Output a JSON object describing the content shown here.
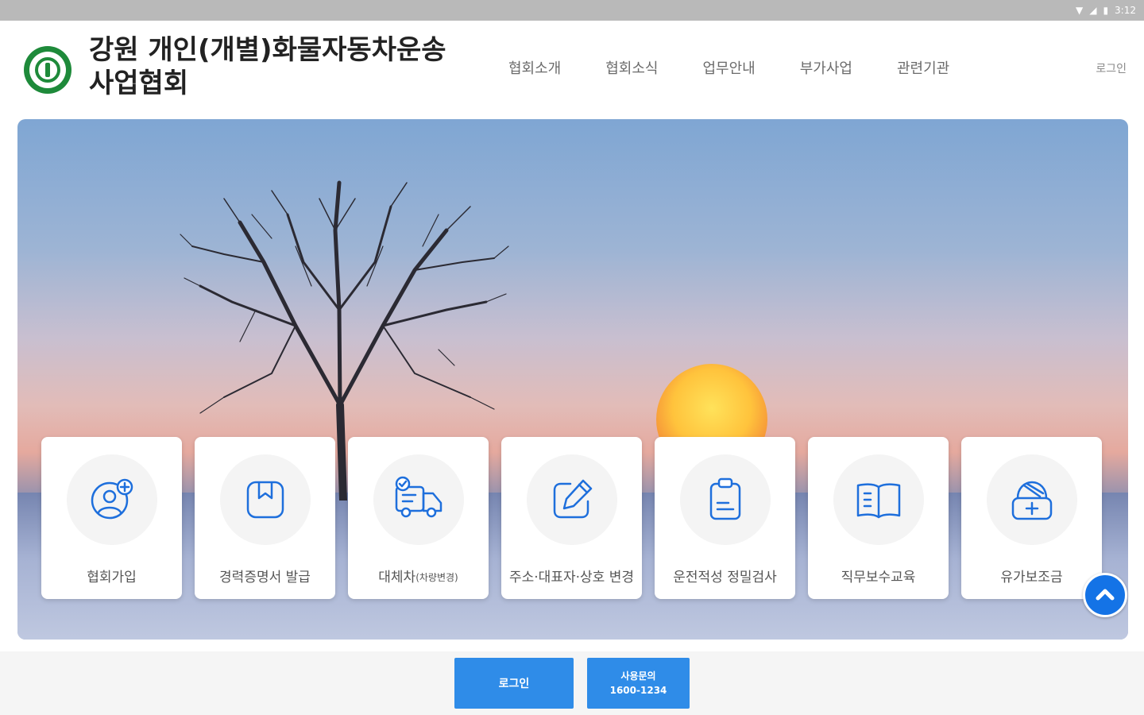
{
  "status_bar": {
    "time": "3:12",
    "icons": [
      "wifi-icon",
      "signal-icon",
      "battery-icon"
    ]
  },
  "header": {
    "title_line1": "강원 개인(개별)화물자동차운송",
    "title_line2": "사업협회",
    "nav": [
      {
        "label": "협회소개"
      },
      {
        "label": "협회소식"
      },
      {
        "label": "업무안내"
      },
      {
        "label": "부가사업"
      },
      {
        "label": "관련기관"
      }
    ],
    "login_label": "로그인"
  },
  "services": [
    {
      "label": "협회가입",
      "icon": "user-add-icon"
    },
    {
      "label": "경력증명서 발급",
      "icon": "bookmark-icon"
    },
    {
      "label": "대체차",
      "sub": "(차량변경)",
      "icon": "truck-check-icon"
    },
    {
      "label": "주소·대표자·상호 변경",
      "icon": "edit-icon"
    },
    {
      "label": "운전적성 정밀검사",
      "icon": "clipboard-icon"
    },
    {
      "label": "직무보수교육",
      "icon": "book-open-icon"
    },
    {
      "label": "유가보조금",
      "icon": "medical-bag-icon"
    }
  ],
  "bottom": {
    "login_button": "로그인",
    "inquiry_line1": "사용문의",
    "inquiry_line2": "1600-1234"
  },
  "colors": {
    "accent": "#2f8ce8",
    "icon_blue": "#1e6fdc",
    "logo_green": "#1e8a3a"
  }
}
